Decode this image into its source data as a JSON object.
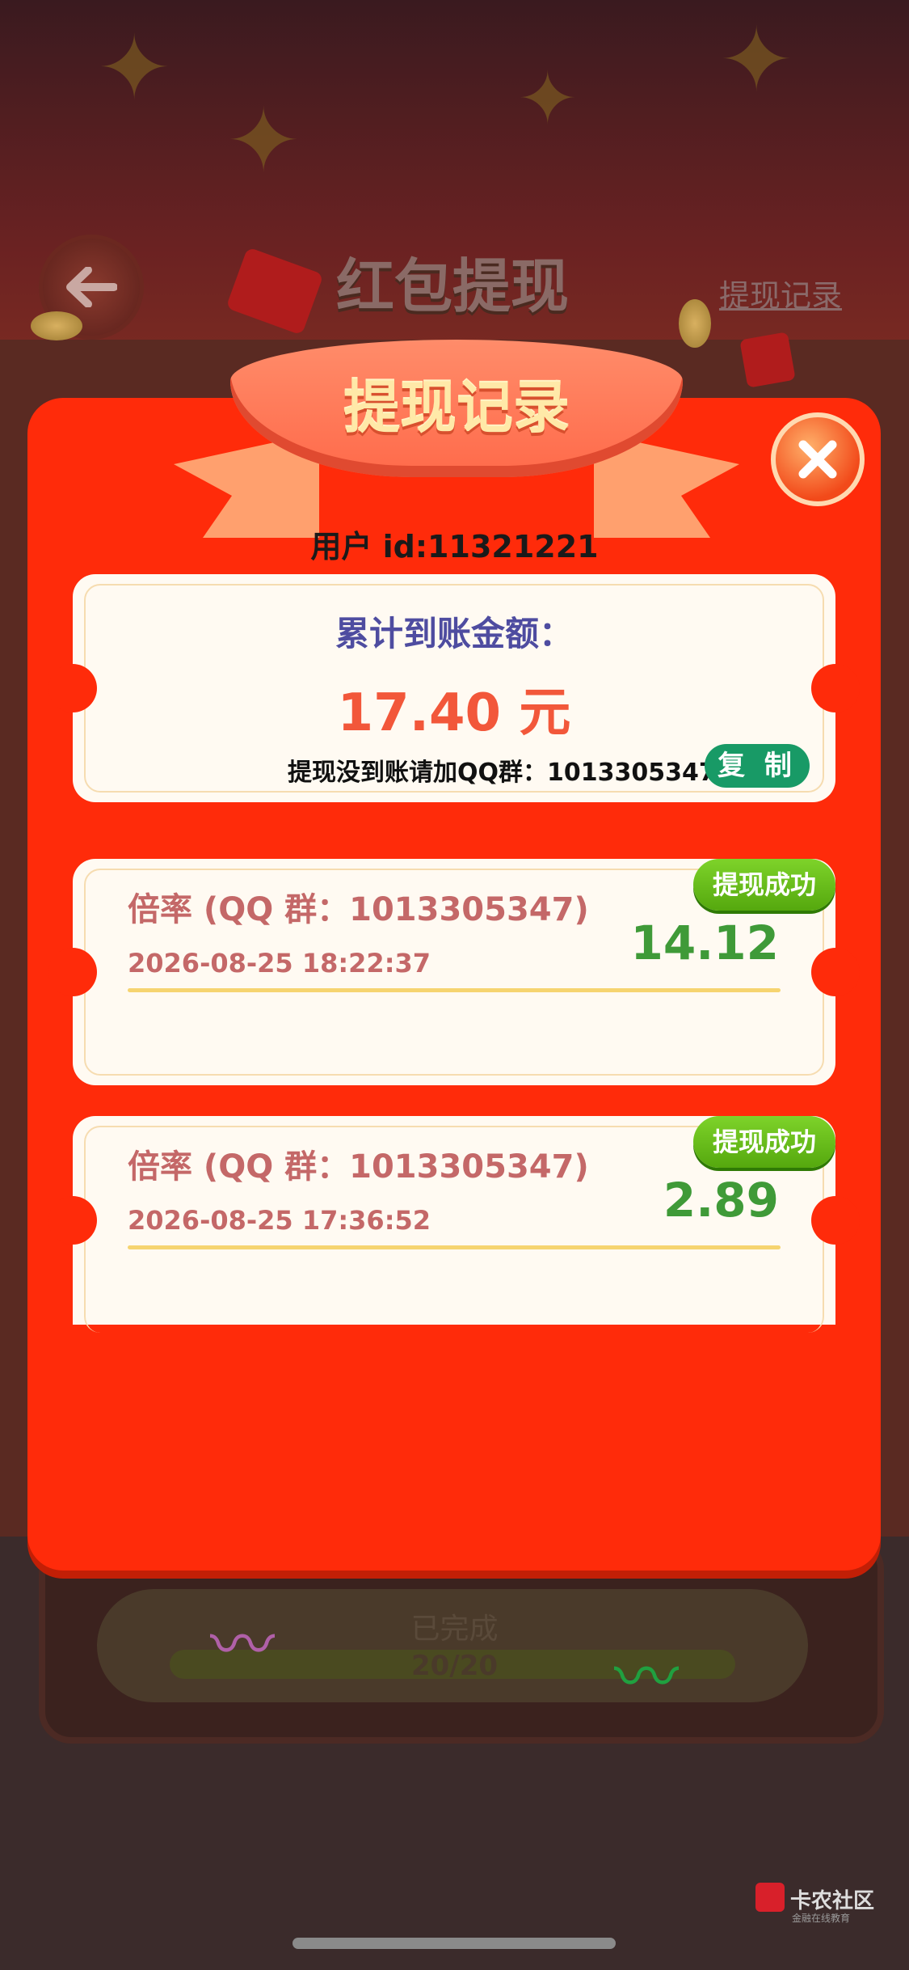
{
  "background": {
    "page_title": "红包提现",
    "history_link": "提现记录",
    "progress_status": "已完成",
    "progress_count": "20/20"
  },
  "modal": {
    "banner_title": "提现记录",
    "user_id": "用户 id:11321221",
    "summary": {
      "title": "累计到账金额：",
      "amount": "17.40 元",
      "note": "提现没到账请加QQ群：1013305347",
      "copy_label": "复 制"
    },
    "records": [
      {
        "title": "倍率 (QQ 群：1013305347)",
        "time": "2026-08-25 18:22:37",
        "amount": "14.12",
        "status": "提现成功"
      },
      {
        "title": "倍率 (QQ 群：1013305347)",
        "time": "2026-08-25 17:36:52",
        "amount": "2.89",
        "status": "提现成功"
      }
    ]
  },
  "watermark": {
    "text": "卡农社区",
    "sub": "金融在线教育"
  },
  "colors": {
    "modal_red": "#ff2b0a",
    "success_green": "#55a80e",
    "copy_green": "#189a66",
    "amount_orange": "#f2573a"
  }
}
